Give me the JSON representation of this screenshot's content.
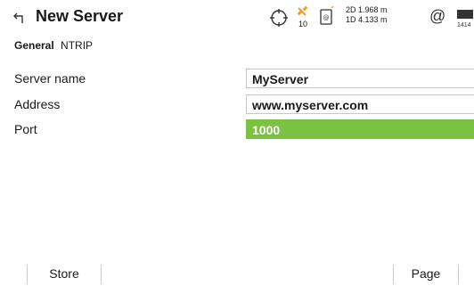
{
  "header": {
    "title": "New Server",
    "satellites": "10",
    "precision_2d": "2D 1.968 m",
    "precision_1d": "1D 4.133 m",
    "connection_symbol": "@",
    "battery_label": "1414",
    "icons": {
      "back": "back-arrow-icon",
      "target": "crosshair-target-icon",
      "satellite": "satellite-icon",
      "device": "device-icon",
      "battery": "battery-icon"
    },
    "colors": {
      "satellite_accent": "#f0a020"
    }
  },
  "tabs": [
    {
      "label": "General",
      "active": true
    },
    {
      "label": "NTRIP",
      "active": false
    }
  ],
  "form": {
    "server_name": {
      "label": "Server name",
      "value": "MyServer"
    },
    "address": {
      "label": "Address",
      "value": "www.myserver.com"
    },
    "port": {
      "label": "Port",
      "value": "1000",
      "focused": true
    }
  },
  "softkeys": {
    "f1": "Store",
    "f6": "Page"
  },
  "colors": {
    "focus_green": "#7cc242",
    "field_border": "#c8c8c8"
  }
}
